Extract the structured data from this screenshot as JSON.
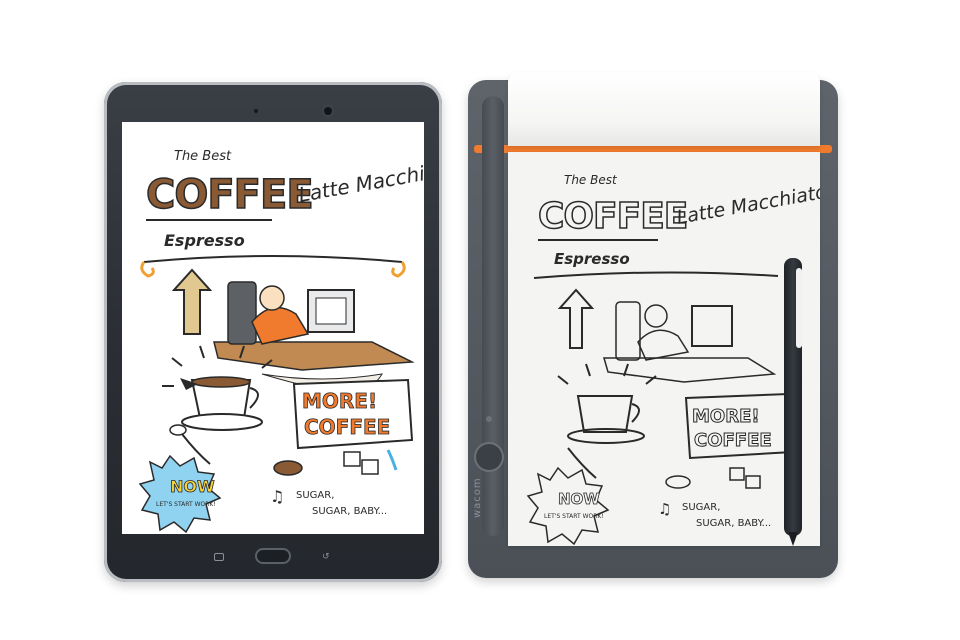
{
  "colors": {
    "tablet_frame": "#2b2f35",
    "pad_body": "#55595f",
    "accent_orange": "#f07b2e",
    "coffee_brown": "#8a5a35",
    "highlight_yellow": "#f7d23a",
    "sky_blue": "#8fd3f0",
    "sketch_ink": "#2a2a2a"
  },
  "tablet_sketch": {
    "line1": "The Best",
    "title": "COFFEE",
    "subtitle": "Espresso",
    "script": "Latte Macchiato",
    "burst1": "MORE!",
    "burst2": "COFFEE",
    "badge": "NOW",
    "badge_sub": "LET'S START WORK!",
    "footer1": "SUGAR,",
    "footer2": "SUGAR, BABY...",
    "note_icon": "music-note-icon"
  },
  "paper_sketch": {
    "line1": "The Best",
    "title": "COFFEE",
    "subtitle": "Espresso",
    "script": "Latte Macchiato",
    "burst1": "MORE!",
    "burst2": "COFFEE",
    "badge": "NOW",
    "badge_sub": "LET'S START WORK!",
    "footer1": "SUGAR,",
    "footer2": "SUGAR, BABY...",
    "note_icon": "music-note-icon"
  },
  "pad": {
    "brand": "wacom"
  }
}
